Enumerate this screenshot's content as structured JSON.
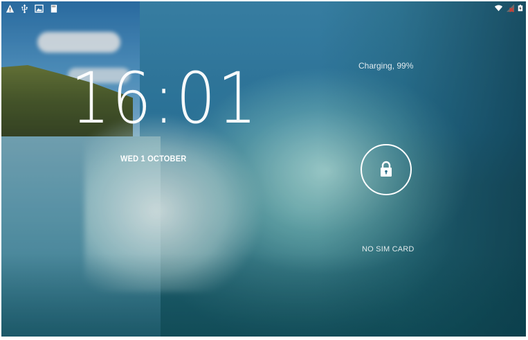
{
  "status_bar": {
    "left_icons": [
      "warning-icon",
      "usb-icon",
      "image-icon",
      "storage-icon"
    ],
    "right_icons": [
      "wifi-icon",
      "signal-no-sim-icon",
      "battery-charging-icon"
    ]
  },
  "lockscreen": {
    "time": "16:01",
    "date": "WED 1 OCTOBER",
    "charging": "Charging, 99%",
    "carrier": "NO SIM CARD",
    "unlock_icon": "lock-icon"
  }
}
